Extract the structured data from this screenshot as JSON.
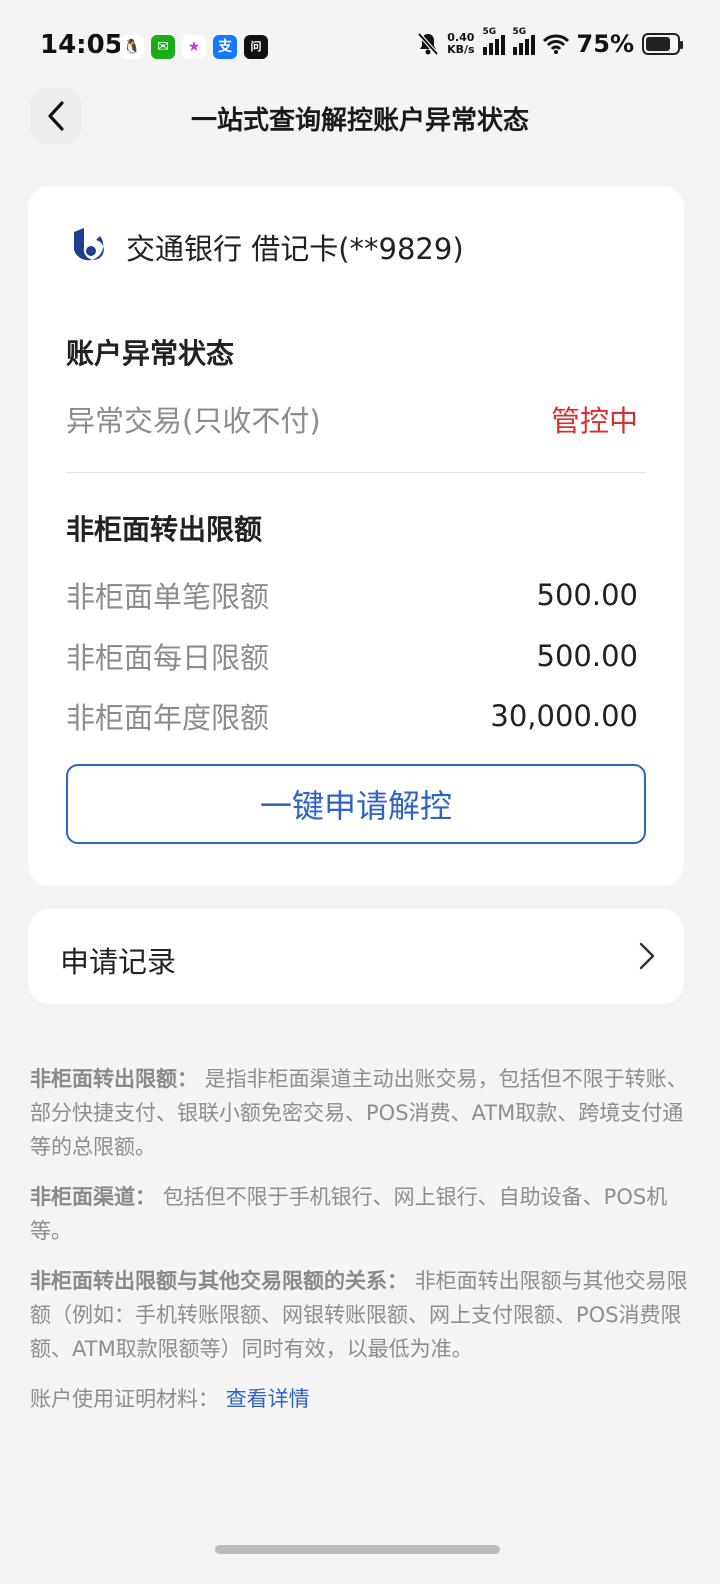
{
  "status_bar": {
    "time": "14:05",
    "net_speed_value": "0.40",
    "net_speed_unit": "KB/s",
    "signal_tag": "5G",
    "battery": "75%",
    "battery_level": 0.75,
    "apps": [
      {
        "icon": "qq-icon",
        "color": "#ffffff",
        "glyph": "🐧"
      },
      {
        "icon": "wechat-icon",
        "color": "#1aad19",
        "glyph": "✉"
      },
      {
        "icon": "app-star-icon",
        "color": "#ffffff",
        "glyph": "★"
      },
      {
        "icon": "alipay-icon",
        "color": "#1677ff",
        "glyph": "支"
      },
      {
        "icon": "toutiao-icon",
        "color": "#111111",
        "glyph": "问"
      }
    ]
  },
  "header": {
    "title": "一站式查询解控账户异常状态"
  },
  "account": {
    "bank_name": "交通银行 借记卡(**9829)",
    "status_section_title": "账户异常状态",
    "status_label": "异常交易(只收不付)",
    "status_value": "管控中",
    "status_color": "#d8302f",
    "limit_section_title": "非柜面转出限额",
    "limits": [
      {
        "label": "非柜面单笔限额",
        "value": "500.00"
      },
      {
        "label": "非柜面每日限额",
        "value": "500.00"
      },
      {
        "label": "非柜面年度限额",
        "value": "30,000.00"
      }
    ],
    "unlock_button": "一键申请解控",
    "accent_color": "#2f64c7"
  },
  "records": {
    "label": "申请记录"
  },
  "notes": {
    "n1_term": "非柜面转出限额：",
    "n1_text": "是指非柜面渠道主动出账交易，包括但不限于转账、部分快捷支付、银联小额免密交易、POS消费、ATM取款、跨境支付通等的总限额。",
    "n2_term": "非柜面渠道：",
    "n2_text": "包括但不限于手机银行、网上银行、自助设备、POS机等。",
    "n3_term": "非柜面转出限额与其他交易限额的关系：",
    "n3_text": "非柜面转出限额与其他交易限额（例如：手机转账限额、网银转账限额、网上支付限额、POS消费限额、ATM取款限额等）同时有效，以最低为准。",
    "n4_text": "账户使用证明材料：",
    "n4_link": "查看详情"
  }
}
